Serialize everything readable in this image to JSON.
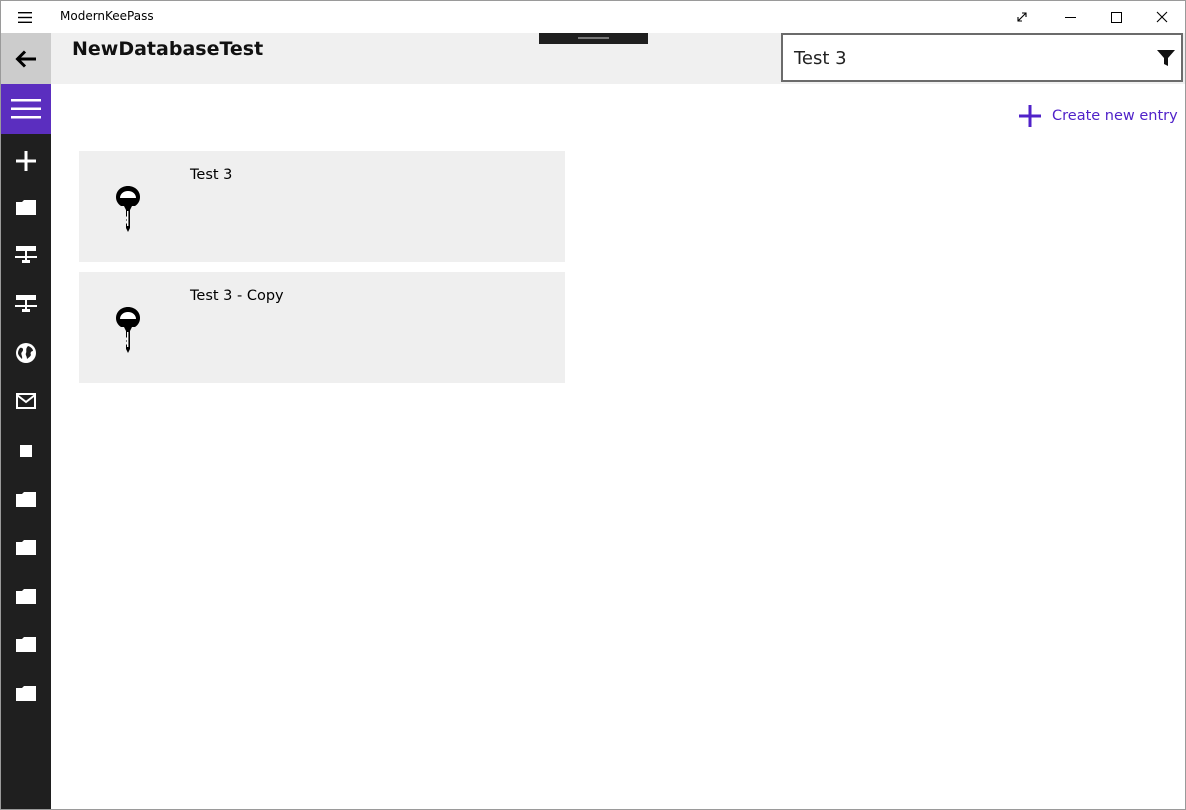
{
  "window": {
    "app_title": "ModernKeePass",
    "controls": {
      "fullscreen_icon": "fullscreen-icon",
      "minimize_icon": "minimize-icon",
      "maximize_icon": "maximize-icon",
      "close_icon": "close-icon"
    }
  },
  "header": {
    "title": "NewDatabaseTest",
    "search": {
      "value": "Test 3",
      "icon": "filter-icon"
    }
  },
  "nav": {
    "items": [
      {
        "icon": "back-arrow-icon"
      },
      {
        "icon": "hamburger-icon"
      },
      {
        "icon": "add-icon"
      },
      {
        "icon": "folder-icon"
      },
      {
        "icon": "network-icon"
      },
      {
        "icon": "network-icon"
      },
      {
        "icon": "globe-icon"
      },
      {
        "icon": "mail-icon"
      },
      {
        "icon": "stop-icon"
      },
      {
        "icon": "folder-icon"
      },
      {
        "icon": "folder-icon"
      },
      {
        "icon": "folder-icon"
      },
      {
        "icon": "folder-icon"
      },
      {
        "icon": "folder-icon"
      }
    ]
  },
  "actions": {
    "create_entry_label": "Create new entry"
  },
  "entries": [
    {
      "title": "Test 3",
      "icon": "key-icon"
    },
    {
      "title": "Test 3 - Copy",
      "icon": "key-icon"
    }
  ],
  "colors": {
    "accent": "#5b2ebf",
    "link": "#5022c9",
    "rail": "#1f1f1f",
    "entry_bg": "#efefef"
  }
}
